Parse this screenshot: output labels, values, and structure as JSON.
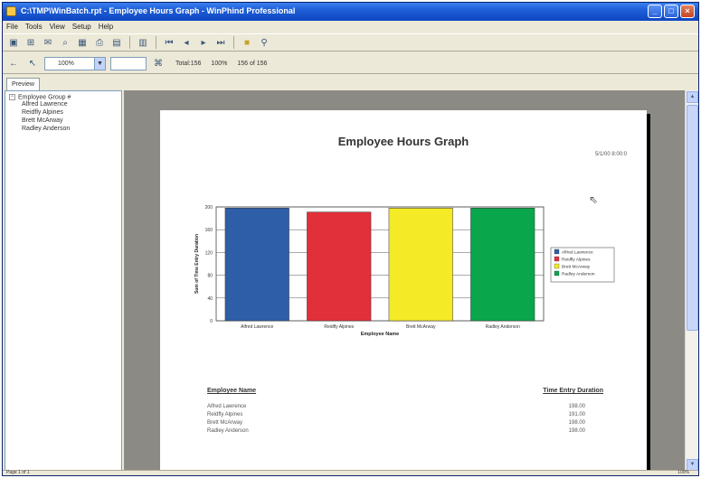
{
  "window": {
    "title": "C:\\TMP\\WinBatch.rpt - Employee Hours Graph - WinPhind Professional",
    "controls": [
      "_",
      "□",
      "×"
    ]
  },
  "menu": [
    "File",
    "Tools",
    "View",
    "Setup",
    "Help"
  ],
  "toolbar2": {
    "zoom_value": "100%",
    "total_label": "Total:156",
    "percent_label": "100%",
    "count_label": "156 of 156"
  },
  "tab_label": "Preview",
  "tree": {
    "root": "Employee Group #",
    "children": [
      "Alfred Lawrence",
      "Reidfly Alpines",
      "Brett McArway",
      "Radley Anderson"
    ]
  },
  "report": {
    "title": "Employee Hours Graph",
    "date": "5/1/00 8:00:0"
  },
  "chart_data": {
    "type": "bar",
    "categories": [
      "Alfred Lawrence",
      "Reidfly Alpines",
      "Brett McArway",
      "Radley Anderson"
    ],
    "values": [
      198,
      191,
      198,
      198
    ],
    "colors": [
      "#2f5ea8",
      "#e2303a",
      "#f4ea26",
      "#0aa64c"
    ],
    "ylim": [
      0,
      200
    ],
    "yticks": [
      0,
      40,
      80,
      120,
      160,
      200
    ],
    "xlabel": "Employee Name",
    "ylabel": "Sum of Time Entry Duration",
    "legend_position": "right",
    "grid": true
  },
  "table": {
    "header_name": "Employee Name",
    "header_value": "Time Entry Duration",
    "rows": [
      {
        "name": "Alfred Lawrence",
        "value": "198.00"
      },
      {
        "name": "Reidfly Alpines",
        "value": "191.00"
      },
      {
        "name": "Brett McArway",
        "value": "198.00"
      },
      {
        "name": "Radley Anderson",
        "value": "198.00"
      }
    ]
  },
  "status": {
    "left": "Page 1 of 1",
    "right": "100%"
  }
}
